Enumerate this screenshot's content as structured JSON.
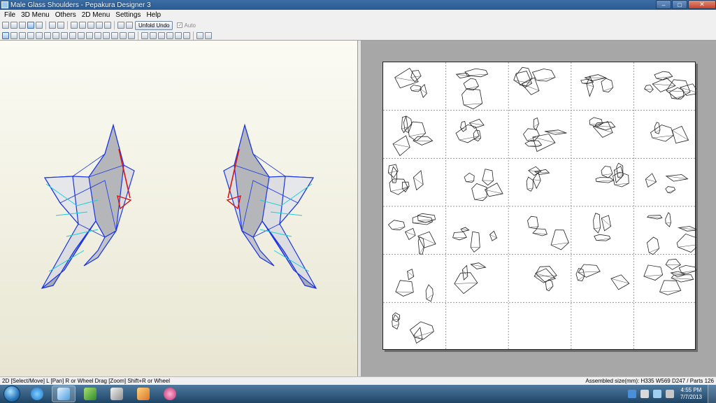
{
  "window": {
    "title": "Male Glass Shoulders - Pepakura Designer 3",
    "controls": [
      "–",
      "□",
      "✕"
    ]
  },
  "menu": [
    "File",
    "3D Menu",
    "Others",
    "2D Menu",
    "Settings",
    "Help"
  ],
  "toolbar": {
    "unfold_undo_label": "Unfold Undo",
    "auto_label": "Auto",
    "auto_checked": true
  },
  "status": {
    "left": "2D [Select/Move] L [Pan] R or Wheel Drag [Zoom] Shift+R or Wheel",
    "right": "Assembled size(mm): H335 W569 D247 / Parts 126"
  },
  "layout_2d": {
    "paper_columns": 5,
    "paper_rows": 6,
    "filled_cells": 26
  },
  "taskbar": {
    "apps": [
      "start-orb",
      "internet-explorer-icon",
      "pepakura-icon",
      "app-leaf-icon",
      "app-grid-icon",
      "app-box-icon",
      "app-orange-icon"
    ],
    "clock_time": "4:55 PM",
    "clock_date": "7/7/2013"
  },
  "colors": {
    "model_edge": "#1a35e6",
    "model_highlight": "#17d0d6",
    "cut_line": "#e01010",
    "paper_bg": "#ffffff",
    "canvas_bg": "#a7a7a7"
  }
}
